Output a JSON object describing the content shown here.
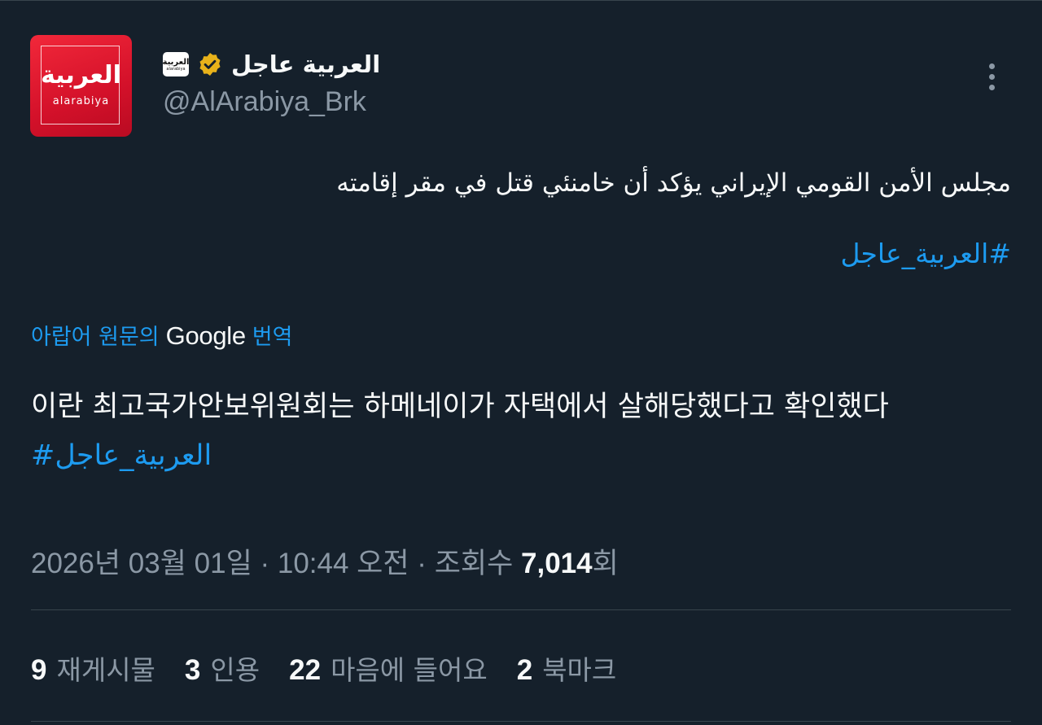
{
  "author": {
    "display_name": "العربية عاجل",
    "handle": "@AlArabiya_Brk",
    "avatar_logo_ar": "العربية",
    "avatar_logo_en": "alarabiya",
    "verified": true,
    "badge_color": "#e8b21a"
  },
  "tweet": {
    "text_ar": "مجلس الأمن القومي الإيراني يؤكد أن خامنئي قتل في مقر إقامته",
    "hashtag_ar": "#العربية_عاجل"
  },
  "translate": {
    "prefix": "아랍어 원문의",
    "brand": "Google",
    "suffix": "번역"
  },
  "translation": {
    "text": "이란 최고국가안보위원회는 하메네이가 자택에서 살해당했다고 확인했다 ",
    "hashtag": "#العربية_عاجل"
  },
  "meta": {
    "datetime": "2026년 03월 01일 · 10:44 오전 · 조회수 ",
    "views": "7,014",
    "views_suffix": "회"
  },
  "stats": {
    "reposts": {
      "count": "9",
      "label": "재게시물"
    },
    "quotes": {
      "count": "3",
      "label": "인용"
    },
    "likes": {
      "count": "22",
      "label": "마음에 들어요"
    },
    "bookmarks": {
      "count": "2",
      "label": "북마크"
    }
  },
  "colors": {
    "background": "#15202b",
    "link": "#1d9bf0",
    "secondary_text": "#8b98a5",
    "brand_red": "#e0152e"
  },
  "icons": {
    "more": "more-vertical-icon",
    "verified": "verified-badge-icon"
  }
}
